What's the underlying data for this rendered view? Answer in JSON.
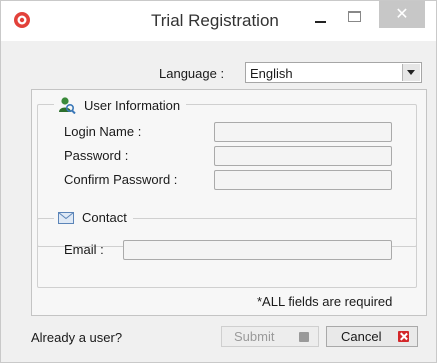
{
  "window": {
    "title": "Trial Registration",
    "app_icon": "app-logo-icon",
    "controls": {
      "minimize": "minimize-icon",
      "maximize": "maximize-icon",
      "close": "close-icon",
      "close_glyph": "✕"
    }
  },
  "language": {
    "label": "Language :",
    "selected": "English"
  },
  "user_information": {
    "legend": "User Information",
    "icon": "user-search-icon",
    "fields": [
      {
        "label": "Login Name :",
        "value": ""
      },
      {
        "label": "Password :",
        "value": ""
      },
      {
        "label": "Confirm Password :",
        "value": ""
      }
    ]
  },
  "contact": {
    "legend": "Contact",
    "icon": "envelope-icon",
    "email_label": "Email :",
    "email_value": ""
  },
  "required_note": "*ALL fields are required",
  "footer": {
    "already_user": "Already a user?",
    "submit_label": "Submit",
    "submit_enabled": false,
    "cancel_label": "Cancel"
  },
  "colors": {
    "close_button": "#c7c7c7",
    "cancel_icon": "#d3272a",
    "app_icon": "#e2413a"
  }
}
